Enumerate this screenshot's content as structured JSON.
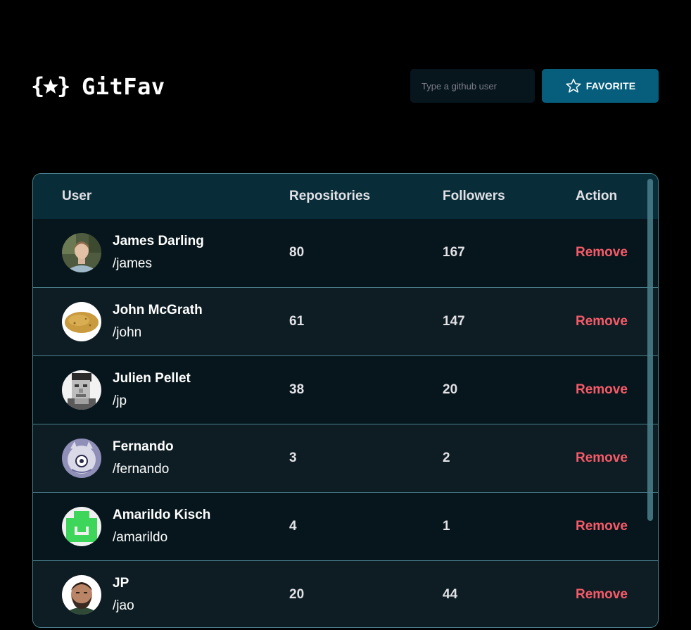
{
  "header": {
    "logo_text": "GitFav",
    "search_placeholder": "Type a github user",
    "favorite_label": "FAVORITE"
  },
  "table": {
    "columns": [
      "User",
      "Repositories",
      "Followers",
      "Action"
    ],
    "rows": [
      {
        "name": "James Darling",
        "login": "/james",
        "repositories": "80",
        "followers": "167",
        "action": "Remove"
      },
      {
        "name": "John McGrath",
        "login": "/john",
        "repositories": "61",
        "followers": "147",
        "action": "Remove"
      },
      {
        "name": "Julien Pellet",
        "login": "/jp",
        "repositories": "38",
        "followers": "20",
        "action": "Remove"
      },
      {
        "name": "Fernando",
        "login": "/fernando",
        "repositories": "3",
        "followers": "2",
        "action": "Remove"
      },
      {
        "name": "Amarildo Kisch",
        "login": "/amarildo",
        "repositories": "4",
        "followers": "1",
        "action": "Remove"
      },
      {
        "name": "JP",
        "login": "/jao",
        "repositories": "20",
        "followers": "44",
        "action": "Remove"
      }
    ]
  },
  "icons": {
    "logo": "braces-star-icon",
    "favorite": "star-outline-icon",
    "avatars": [
      "avatar-photo-icon",
      "potato-avatar-icon",
      "pixel-portrait-avatar-icon",
      "cartoon-avatar-icon",
      "green-identicon-avatar-icon",
      "bearded-man-avatar-icon"
    ]
  },
  "colors": {
    "background": "#000000",
    "button": "#065E7C",
    "header_row": "#092D38",
    "row_odd": "#06161C",
    "row_even": "#0D1D23",
    "border": "#4A808C",
    "remove": "#F75A68"
  }
}
